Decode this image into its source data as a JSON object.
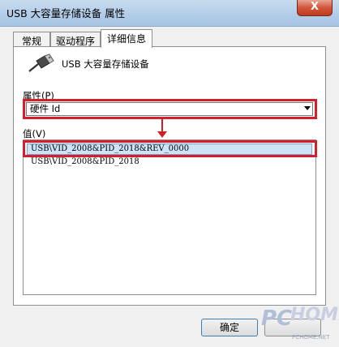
{
  "window": {
    "title": "USB 大容量存储设备 属性",
    "close_label": "X"
  },
  "tabs": [
    {
      "label": "常规",
      "active": false
    },
    {
      "label": "驱动程序",
      "active": false
    },
    {
      "label": "详细信息",
      "active": true
    }
  ],
  "device": {
    "name": "USB 大容量存储设备",
    "icon": "usb-connector-icon"
  },
  "property": {
    "label": "属性(P)",
    "selected": "硬件 Id"
  },
  "values": {
    "label": "值(V)",
    "items": [
      "USB\\VID_2008&PID_2018&REV_0000",
      "USB\\VID_2008&PID_2018"
    ],
    "selected_index": 0
  },
  "buttons": {
    "ok": "确定"
  },
  "watermark": {
    "brand_a": "PC",
    "brand_b": "HOME",
    "url": "PCHOME.NET"
  },
  "colors": {
    "annotation_red": "#d21f2a",
    "selection_blue": "#cde3f7"
  }
}
